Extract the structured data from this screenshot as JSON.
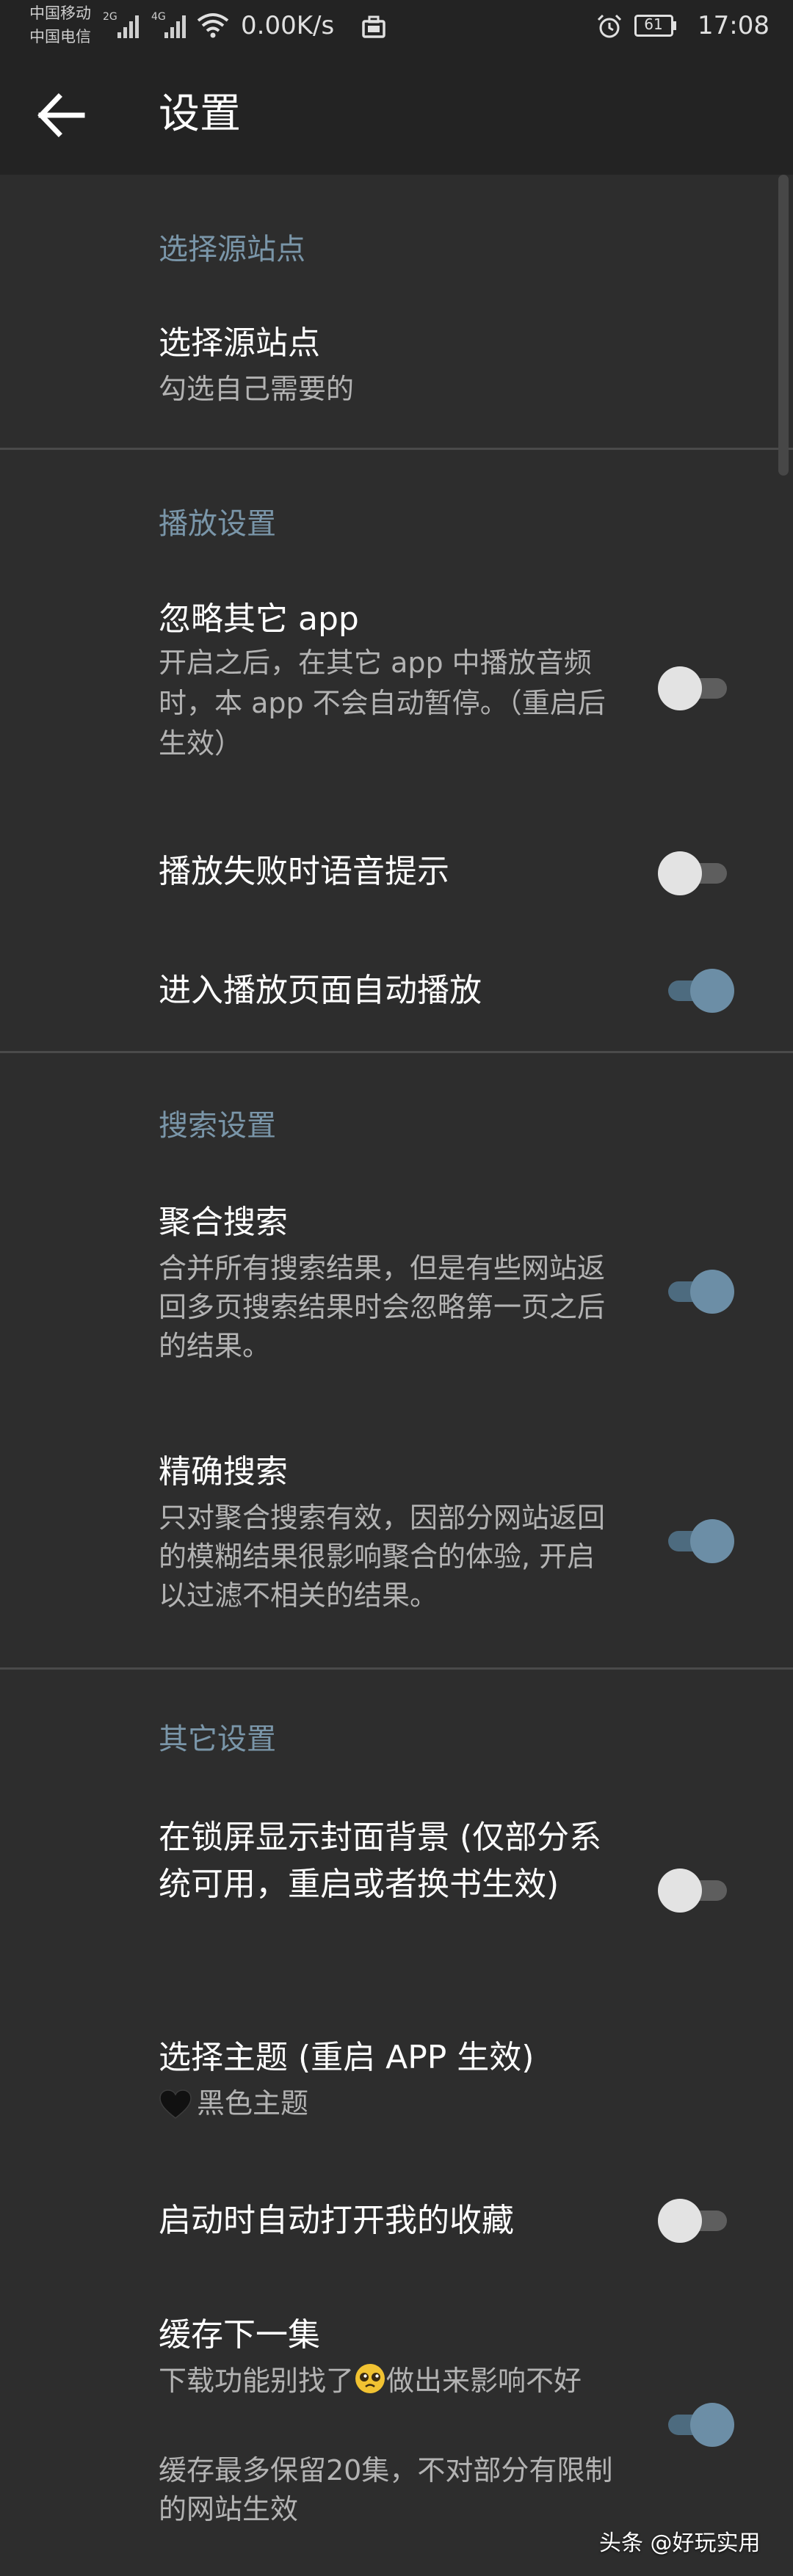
{
  "status_bar": {
    "carrier_1": "中国移动",
    "carrier_2": "中国电信",
    "sim1_tag": "2G",
    "sim2_tag": "4G",
    "net_speed": "0.00K/s",
    "battery": "61",
    "time": "17:08",
    "icons": [
      "signal-icon",
      "wifi-icon",
      "shopping-bag-icon",
      "alarm-icon",
      "battery-icon"
    ]
  },
  "toolbar": {
    "title": "设置",
    "back_icon": "arrow-left-icon"
  },
  "sections": {
    "source": {
      "header": "选择源站点",
      "items": [
        {
          "title": "选择源站点",
          "summary": "勾选自己需要的"
        }
      ]
    },
    "playback": {
      "header": "播放设置",
      "items": [
        {
          "title": "忽略其它 app",
          "summary": "开启之后，在其它 app 中播放音频时，本 app 不会自动暂停。（重启后生效）",
          "checked": false
        },
        {
          "title": "播放失败时语音提示",
          "checked": false
        },
        {
          "title": "进入播放页面自动播放",
          "checked": true
        }
      ]
    },
    "search": {
      "header": "搜索设置",
      "items": [
        {
          "title": "聚合搜索",
          "summary": "合并所有搜索结果，但是有些网站返回多页搜索结果时会忽略第一页之后的结果。",
          "checked": true
        },
        {
          "title": "精确搜索",
          "summary": "只对聚合搜索有效，因部分网站返回的模糊结果很影响聚合的体验, 开启以过滤不相关的结果。",
          "checked": true
        }
      ]
    },
    "other": {
      "header": "其它设置",
      "items": [
        {
          "title": "在锁屏显示封面背景 (仅部分系统可用，重启或者换书生效)",
          "checked": false
        },
        {
          "title": "选择主题 (重启 APP 生效)",
          "summary": "黑色主题",
          "summary_icon": "black-heart-icon"
        },
        {
          "title": "启动时自动打开我的收藏",
          "checked": false
        },
        {
          "title": "缓存下一集",
          "summary_before_emoji": "下载功能别找了",
          "summary_emoji": "pleading-face-icon",
          "summary_after_emoji": "做出来影响不好",
          "summary_line_2": "缓存最多保留20集，不对部分有限制的网站生效",
          "checked": true
        }
      ]
    }
  },
  "watermark": "头条 @好玩实用",
  "colors": {
    "background": "#2d2d2d",
    "toolbar": "#232323",
    "section_header": "#7a96a9",
    "summary_text": "#b3b3b3",
    "divider": "#4a4a4a",
    "switch_on_track": "#4d6b7f",
    "switch_on_thumb": "#6c8ea6",
    "switch_off_track": "#5e5e5e",
    "switch_off_thumb": "#e3e3e3"
  }
}
